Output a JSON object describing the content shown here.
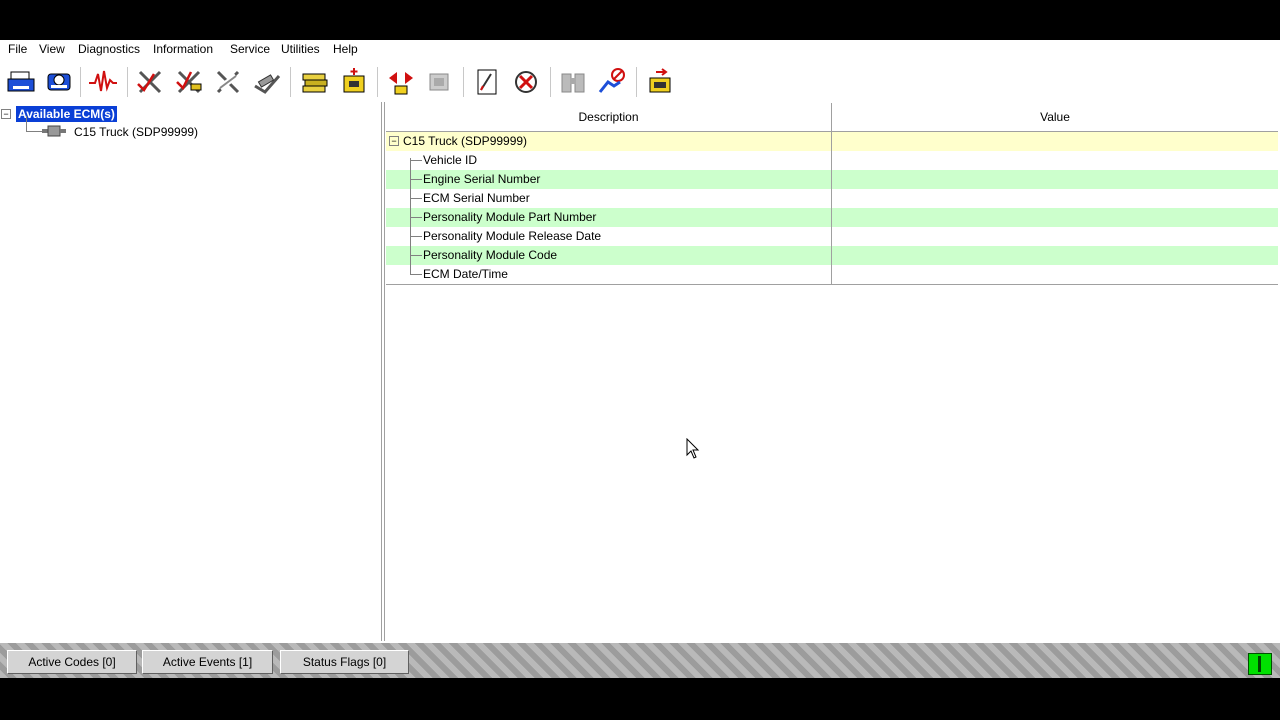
{
  "menu": [
    "File",
    "View",
    "Diagnostics",
    "Information",
    "Service",
    "Utilities",
    "Help"
  ],
  "toolbar_icons": [
    "print-icon",
    "print-preview-icon",
    "waveform-icon",
    "diagnostic-check-icon",
    "diagnostic-edit-icon",
    "diagnostic-clear-icon",
    "diagnostic-off-icon",
    "ecm-summary-icon",
    "ecm-add-icon",
    "data-link-icon",
    "ecm-disabled-icon",
    "flash-icon",
    "calibration-icon",
    "binoculars-icon",
    "disconnect-icon",
    "ecm-exit-icon"
  ],
  "tree": {
    "root_label": "Available ECM(s)",
    "child_label": "C15 Truck (SDP99999)"
  },
  "grid": {
    "col_description": "Description",
    "col_value": "Value",
    "group_label": "C15 Truck (SDP99999)",
    "rows": [
      {
        "label": "Vehicle ID",
        "value": ""
      },
      {
        "label": "Engine Serial Number",
        "value": ""
      },
      {
        "label": "ECM Serial Number",
        "value": ""
      },
      {
        "label": "Personality Module Part Number",
        "value": ""
      },
      {
        "label": "Personality Module Release Date",
        "value": ""
      },
      {
        "label": "Personality Module Code",
        "value": ""
      },
      {
        "label": "ECM Date/Time",
        "value": ""
      }
    ]
  },
  "status_buttons": {
    "active_codes": "Active Codes [0]",
    "active_events": "Active Events [1]",
    "status_flags": "Status Flags [0]"
  },
  "colors": {
    "selection": "#0a3fd6",
    "group_row": "#ffffcc",
    "alt_row": "#ccffcc",
    "status_indicator": "#00e000"
  }
}
